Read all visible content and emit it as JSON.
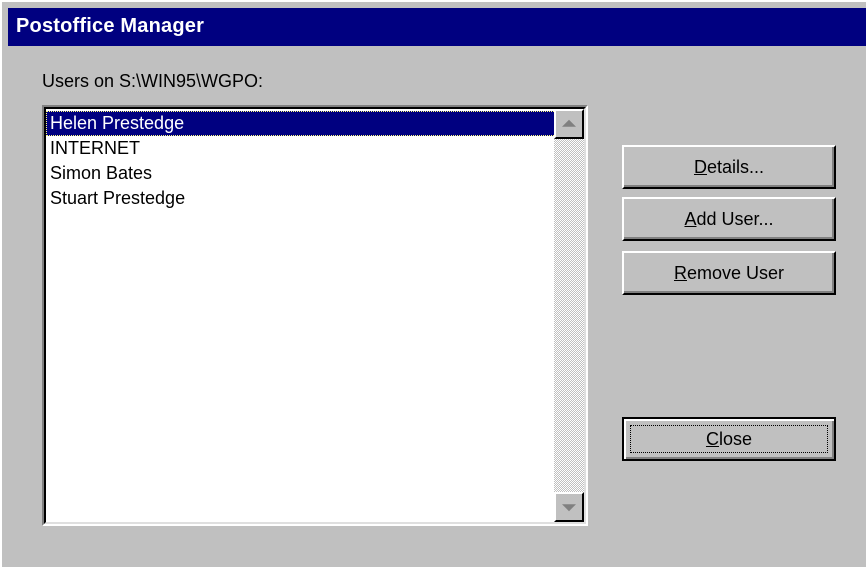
{
  "window": {
    "title": "Postoffice Manager"
  },
  "users_label": "Users on S:\\WIN95\\WGPO:",
  "users": [
    {
      "name": "Helen Prestedge",
      "selected": true
    },
    {
      "name": "INTERNET",
      "selected": false
    },
    {
      "name": "Simon Bates",
      "selected": false
    },
    {
      "name": "Stuart Prestedge",
      "selected": false
    }
  ],
  "buttons": {
    "details": {
      "mnemonic": "D",
      "rest": "etails..."
    },
    "add_user": {
      "mnemonic": "A",
      "rest": "dd User..."
    },
    "remove_user": {
      "mnemonic": "R",
      "rest": "emove User"
    },
    "close": {
      "mnemonic": "C",
      "rest": "lose"
    }
  },
  "colors": {
    "face": "#c0c0c0",
    "titlebar": "#000080",
    "selection": "#000080",
    "list_background": "#ffffff"
  },
  "icons": {
    "scroll_up": "scroll-up-arrow-icon",
    "scroll_down": "scroll-down-arrow-icon"
  }
}
